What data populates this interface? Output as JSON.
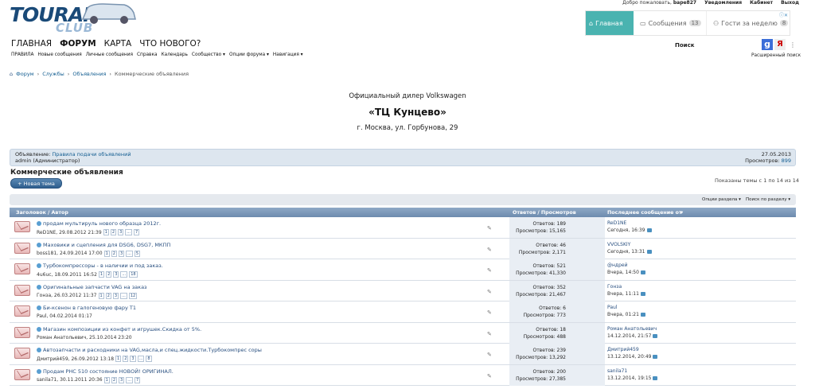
{
  "logo": {
    "main": "TOURAN",
    "sub": "CLUB"
  },
  "userbar": {
    "welcome": "Добро пожаловать,",
    "user": "bape827",
    "notifications": "Уведомления",
    "cabinet": "Кабинет",
    "exit": "Выход"
  },
  "ad": {
    "home": "Главная",
    "messages": "Сообщения",
    "messages_count": "13",
    "guests": "Гости за неделю",
    "guests_count": "8"
  },
  "mainnav": [
    "ГЛАВНАЯ",
    "ФОРУМ",
    "КАРТА",
    "ЧТО НОВОГО?"
  ],
  "subnav": [
    "ПРАВИЛА",
    "Новые сообщения",
    "Личные сообщения",
    "Справка",
    "Календарь",
    "Сообщество ▾",
    "Опции форума ▾",
    "Навигация ▾"
  ],
  "search": {
    "label": "Поиск",
    "advanced": "Расширенный поиск"
  },
  "breadcrumb": [
    "Форум",
    "Службы",
    "Объявления",
    "Коммерческие объявления"
  ],
  "dealer": {
    "line1": "Официальный дилер Volkswagen",
    "line2": "«ТЦ Кунцево»",
    "line3": "г. Москва, ул. Горбунова, 29"
  },
  "notice": {
    "prefix": "Объявление:",
    "link": "Правила подачи объявлений",
    "author": "admin (Администратор)",
    "date": "27.05.2013",
    "views_label": "Просмотров:",
    "views": "899"
  },
  "forum": {
    "title": "Коммерческие объявления",
    "new_topic": "+ Новая тема",
    "pager": "Показаны темы с 1 по 14 из 14",
    "options": "Опции раздела ▾",
    "search": "Поиск по разделу ▾"
  },
  "columns": {
    "title": "Заголовок / Автор",
    "stats": "Ответов / Просмотров",
    "last": "Последнее сообщение от"
  },
  "threads": [
    {
      "title": "продам мультируль нового образца 2012г.",
      "author": "ReD1NE, 29.08.2012 21:39",
      "pages": [
        "1",
        "2",
        "3",
        "...",
        "7"
      ],
      "replies": "Ответов: 189",
      "views": "Просмотров: 15,165",
      "last_user": "ReD1NE",
      "last_time": "Сегодня, 16:39"
    },
    {
      "title": "Маховики и сцепления для DSG6, DSG7, МКПП",
      "author": "boss181, 24.09.2014 17:00",
      "pages": [
        "1",
        "2",
        "3",
        "...",
        "5"
      ],
      "replies": "Ответов: 46",
      "views": "Просмотров: 2,171",
      "last_user": "VVOLSKIY",
      "last_time": "Сегодня, 13:31"
    },
    {
      "title": "Турбокомпрессоры - в наличии и под заказ.",
      "author": "4u6uc, 18.09.2011 16:52",
      "pages": [
        "1",
        "2",
        "3",
        "...",
        "18"
      ],
      "replies": "Ответов: 521",
      "views": "Просмотров: 41,330",
      "last_user": "@ндрей",
      "last_time": "Вчера, 14:50"
    },
    {
      "title": "Оригинальные запчасти VAG на заказ",
      "author": "Гонзa, 26.03.2012 11:37",
      "pages": [
        "1",
        "2",
        "3",
        "...",
        "12"
      ],
      "replies": "Ответов: 352",
      "views": "Просмотров: 21,467",
      "last_user": "Гонзa",
      "last_time": "Вчера, 11:11"
    },
    {
      "title": "Би-ксенон в галогеновую фару T1",
      "author": "Paul, 04.02.2014 01:17",
      "pages": [],
      "replies": "Ответов: 6",
      "views": "Просмотров: 773",
      "last_user": "Paul",
      "last_time": "Вчера, 01:21"
    },
    {
      "title": "Магазин композиции из конфет и игрушек.Скидка от 5%.",
      "author": "Роман Анатольевич, 25.10.2014 23:20",
      "pages": [],
      "replies": "Ответов: 18",
      "views": "Просмотров: 488",
      "last_user": "Роман Анатольевич",
      "last_time": "14.12.2014, 21:57"
    },
    {
      "title": "Автозапчасти и расходники на VAG,масла,и спец.жидкости.Турбокомпрес соры",
      "author": "Дмитрий459, 26.09.2012 13:18",
      "pages": [
        "1",
        "2",
        "3",
        "...",
        "8"
      ],
      "replies": "Ответов: 239",
      "views": "Просмотров: 13,292",
      "last_user": "Дмитрий459",
      "last_time": "13.12.2014, 20:49"
    },
    {
      "title": "Продам РНС 510 состояние НОВОЙ! ОРИГИНАЛ.",
      "author": "sanila71, 30.11.2011 20:36",
      "pages": [
        "1",
        "2",
        "3",
        "...",
        "7"
      ],
      "replies": "Ответов: 200",
      "views": "Просмотров: 27,385",
      "last_user": "sanila71",
      "last_time": "13.12.2014, 19:15"
    }
  ]
}
